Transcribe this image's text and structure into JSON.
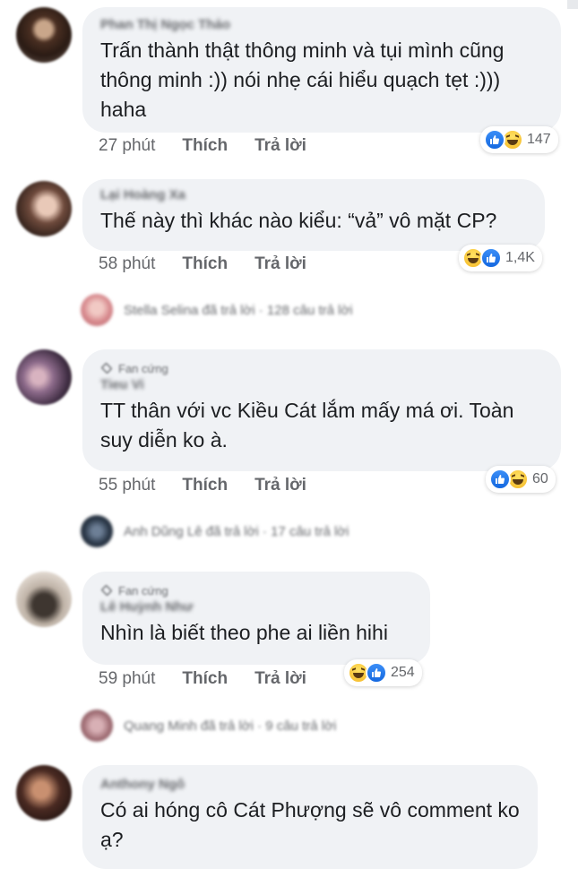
{
  "comments": [
    {
      "name": "Phan Thị Ngọc Thảo",
      "badge": "",
      "text": "Trấn thành thật thông minh và tụi mình cũng thông minh :)) nói nhẹ cái hiểu quạch tẹt :))) haha",
      "time": "27 phút",
      "like": "Thích",
      "reply": "Trả lời",
      "reactions": {
        "icons": [
          "like-icon",
          "haha-icon"
        ],
        "count": "147"
      }
    },
    {
      "name": "Lại Hoàng Xa",
      "badge": "",
      "text": "Thế này thì khác nào kiểu: “vả” vô mặt CP?",
      "time": "58 phút",
      "like": "Thích",
      "reply": "Trả lời",
      "reactions": {
        "icons": [
          "haha-icon",
          "like-icon"
        ],
        "count": "1,4K"
      }
    },
    {
      "name": "Tieu Vi",
      "badge": "Fan cứng",
      "text": "TT thân với vc Kiều Cát lắm mấy má ơi. Toàn suy diễn ko à.",
      "time": "55 phút",
      "like": "Thích",
      "reply": "Trả lời",
      "reactions": {
        "icons": [
          "like-icon",
          "haha-icon"
        ],
        "count": "60"
      }
    },
    {
      "name": "Lê Huỳnh Như",
      "badge": "Fan cứng",
      "text": "Nhìn là biết theo phe ai liền hihi",
      "time": "59 phút",
      "like": "Thích",
      "reply": "Trả lời",
      "reactions": {
        "icons": [
          "haha-icon",
          "like-icon"
        ],
        "count": "254"
      }
    },
    {
      "name": "Anthony Ngô",
      "badge": "",
      "text": "Có ai hóng cô Cát Phượng sẽ vô comment ko ạ?"
    }
  ],
  "replies": [
    {
      "text": "Stella Selina đã trả lời · 128 câu trả lời"
    },
    {
      "text": "Anh Dũng Lê đã trả lời · 17 câu trả lời"
    },
    {
      "text": "Quang Minh đã trả lời · 9 câu trả lời"
    }
  ],
  "colors": {
    "like": "#1877f2",
    "haha": "#f7b928",
    "bubble": "#f0f2f5",
    "meta": "#65676b"
  }
}
